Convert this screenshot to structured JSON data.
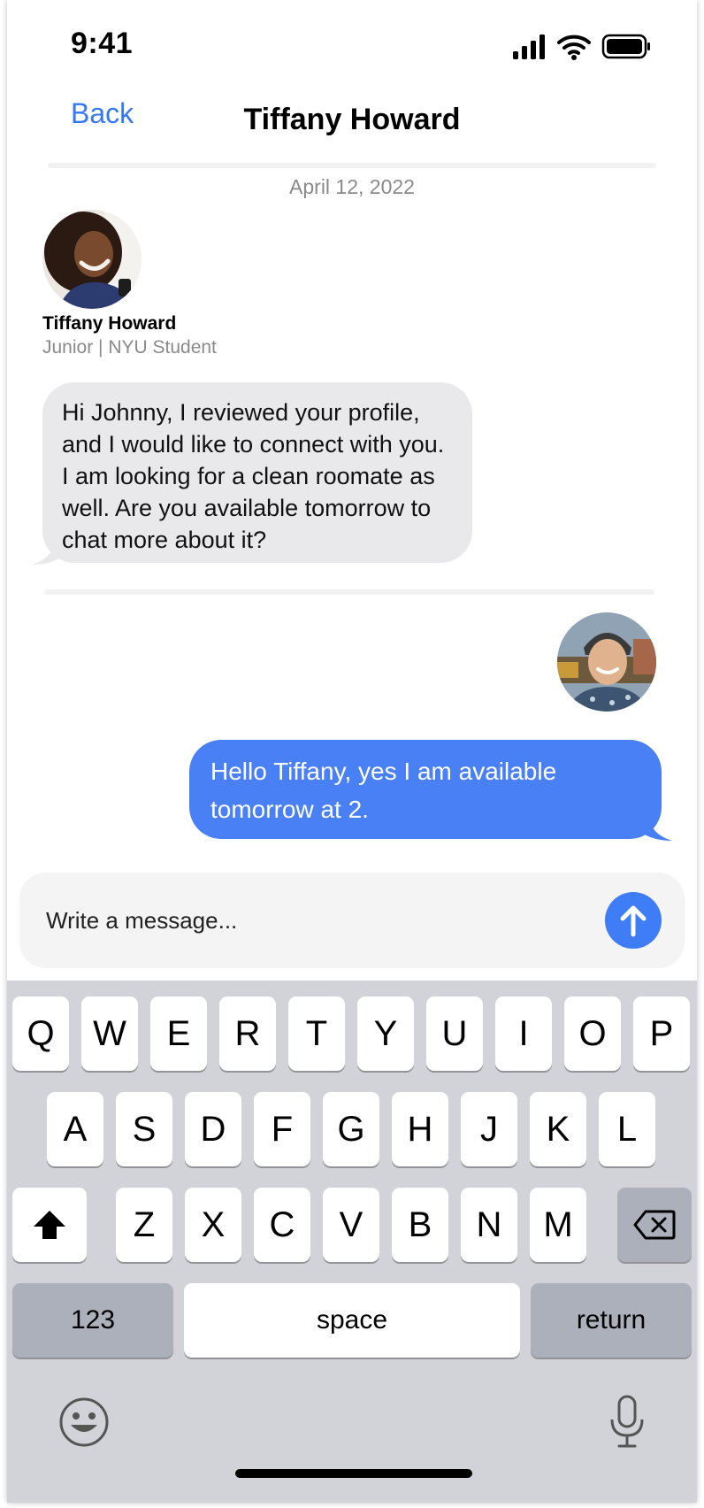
{
  "status_bar": {
    "time": "9:41",
    "icons": [
      "cellular-signal-icon",
      "wifi-icon",
      "battery-icon"
    ]
  },
  "header": {
    "back_label": "Back",
    "title": "Tiffany Howard"
  },
  "conversation": {
    "date": "April 12, 2022",
    "sender": {
      "name": "Tiffany Howard",
      "subtitle": "Junior | NYU Student"
    },
    "incoming_message": "Hi  Johnny,  I reviewed your profile, and I would like to connect with you.  I am looking for a clean roomate as well. Are you available tomorrow to chat more about it?",
    "outgoing_message": "Hello Tiffany, yes I am available tomorrow at 2."
  },
  "composer": {
    "placeholder": "Write a message...",
    "send_icon": "arrow-up-icon"
  },
  "keyboard": {
    "row1": [
      "Q",
      "W",
      "E",
      "R",
      "T",
      "Y",
      "U",
      "I",
      "O",
      "P"
    ],
    "row2": [
      "A",
      "S",
      "D",
      "F",
      "G",
      "H",
      "J",
      "K",
      "L"
    ],
    "row3": [
      "Z",
      "X",
      "C",
      "V",
      "B",
      "N",
      "M"
    ],
    "numbers_label": "123",
    "space_label": "space",
    "return_label": "return",
    "icons": [
      "shift-icon",
      "backspace-icon",
      "emoji-icon",
      "microphone-icon"
    ]
  },
  "colors": {
    "accent": "#3478F6",
    "outgoing_bubble": "#4A80F5",
    "incoming_bubble": "#E9E9EB",
    "keyboard_bg": "#D1D3D9"
  }
}
